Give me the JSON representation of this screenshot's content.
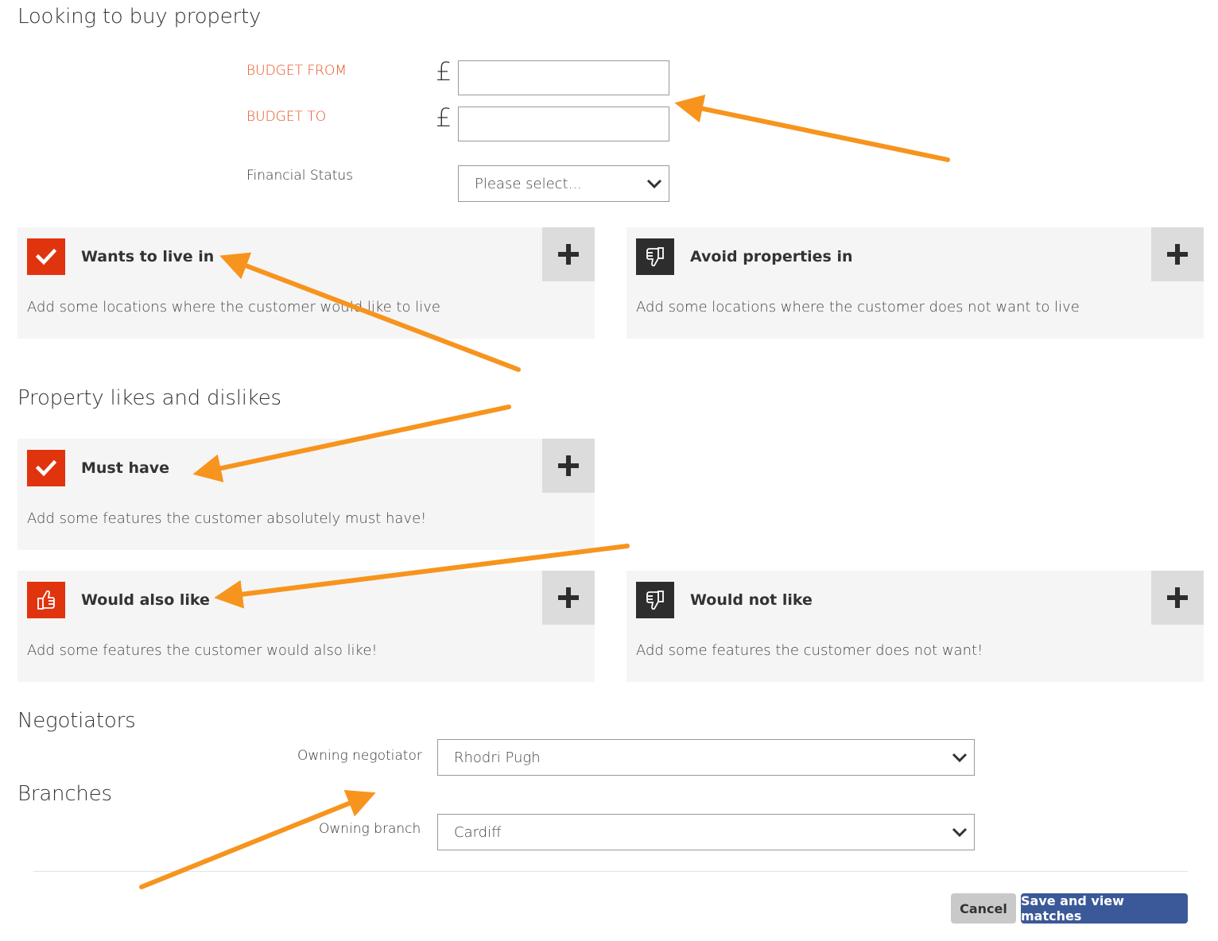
{
  "sections": {
    "buy": "Looking to buy property",
    "likes": "Property likes and dislikes",
    "negotiators": "Negotiators",
    "branches": "Branches"
  },
  "budget": {
    "from_label": "BUDGET FROM",
    "to_label": "BUDGET TO",
    "currency": "£",
    "from_value": "",
    "to_value": ""
  },
  "financial": {
    "label": "Financial Status",
    "selected": "Please select..."
  },
  "cards": {
    "wants": {
      "title": "Wants to live in",
      "desc": "Add some locations where the customer would like to live"
    },
    "avoid": {
      "title": "Avoid properties in",
      "desc": "Add some locations where the customer does not want to live"
    },
    "must": {
      "title": "Must have",
      "desc": "Add some features the customer absolutely must have!"
    },
    "also": {
      "title": "Would also like",
      "desc": "Add some features the customer would also like!"
    },
    "not": {
      "title": "Would not like",
      "desc": "Add some features the customer does not want!"
    }
  },
  "negotiator": {
    "label": "Owning negotiator",
    "selected": "Rhodri Pugh"
  },
  "branch": {
    "label": "Owning branch",
    "selected": "Cardiff"
  },
  "actions": {
    "cancel": "Cancel",
    "save": "Save and view matches"
  },
  "colors": {
    "accent": "#e8501f",
    "badge_red": "#e0340f",
    "badge_dark": "#2d2d2d",
    "primary": "#3b5998",
    "annotation": "#f7941d"
  },
  "icons": {
    "check": "check-icon",
    "thumbs_up": "thumbs-up-icon",
    "thumbs_down": "thumbs-down-icon",
    "plus": "plus-icon",
    "chevron": "chevron-down-icon"
  }
}
